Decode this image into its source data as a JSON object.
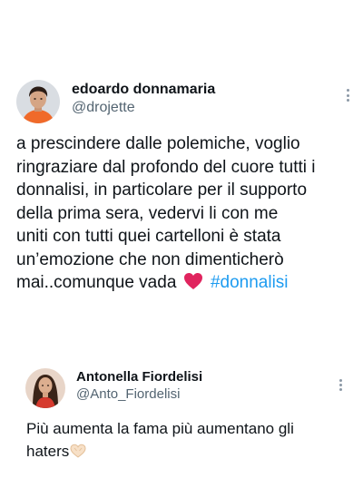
{
  "tweets": [
    {
      "display_name": "edoardo donnamaria",
      "handle": "@drojette",
      "text_lines": [
        "a prescindere dalle polemiche, voglio",
        "ringraziare dal profondo del cuore tutti i",
        "donnalisi, in particolare per il supporto",
        "della prima sera, vedervi li con me",
        "uniti con tutti quei cartelloni è stata",
        "un’emozione che non dimenticherò",
        "mai..comunque vada"
      ],
      "emoji": "red-heart-emoji",
      "hashtag": "#donnalisi"
    },
    {
      "display_name": "Antonella Fiordelisi",
      "handle": "@Anto_Fiordelisi",
      "text_lines": [
        "Più aumenta la fama più aumentano gli",
        "haters"
      ],
      "emoji": "heart-hands-emoji"
    }
  ],
  "colors": {
    "text": "#0f1419",
    "secondary": "#536471",
    "hashtag": "#1d9bf0",
    "heart": "#e0245e"
  }
}
